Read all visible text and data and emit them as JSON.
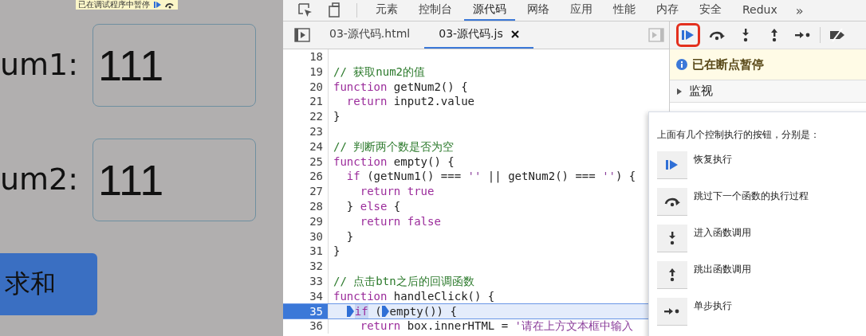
{
  "page": {
    "paused_badge": "已在调试程序中暂停",
    "fields": [
      {
        "label": "um1:",
        "value": "111"
      },
      {
        "label": "um2:",
        "value": "111"
      }
    ],
    "button": "求和"
  },
  "devtools": {
    "tabs": [
      {
        "label": "元素",
        "selected": false
      },
      {
        "label": "控制台",
        "selected": false
      },
      {
        "label": "源代码",
        "selected": true
      },
      {
        "label": "网络",
        "selected": false
      },
      {
        "label": "应用",
        "selected": false
      },
      {
        "label": "性能",
        "selected": false
      },
      {
        "label": "内存",
        "selected": false
      },
      {
        "label": "安全",
        "selected": false
      },
      {
        "label": "Redux",
        "selected": false
      }
    ],
    "more": "»",
    "file_tabs": [
      {
        "label": "03-源代码.html",
        "selected": false,
        "closable": false
      },
      {
        "label": "03-源代码.js",
        "selected": true,
        "closable": true
      }
    ],
    "code": [
      {
        "number": "18",
        "current": false
      },
      {
        "number": "19",
        "current": false,
        "segments": [
          {
            "kind": "comment",
            "text": "// 获取num2的值"
          }
        ]
      },
      {
        "number": "20",
        "current": false,
        "segments": [
          {
            "kind": "keyword",
            "text": "function"
          },
          {
            "kind": "plain",
            "text": " getNum2() {"
          }
        ]
      },
      {
        "number": "21",
        "current": false,
        "segments": [
          {
            "kind": "keyword",
            "text": "  return"
          },
          {
            "kind": "plain",
            "text": " input2.value"
          }
        ]
      },
      {
        "number": "22",
        "current": false,
        "segments": [
          {
            "kind": "plain",
            "text": "}"
          }
        ]
      },
      {
        "number": "23",
        "current": false
      },
      {
        "number": "24",
        "current": false,
        "segments": [
          {
            "kind": "comment",
            "text": "// 判断两个数是否为空"
          }
        ]
      },
      {
        "number": "25",
        "current": false,
        "segments": [
          {
            "kind": "keyword",
            "text": "function"
          },
          {
            "kind": "plain",
            "text": " empty() {"
          }
        ]
      },
      {
        "number": "26",
        "current": false,
        "segments": [
          {
            "kind": "keyword",
            "text": "  if"
          },
          {
            "kind": "plain",
            "text": " (getNum1() === "
          },
          {
            "kind": "string",
            "text": "''"
          },
          {
            "kind": "plain",
            "text": " || getNum2() === "
          },
          {
            "kind": "string",
            "text": "''"
          },
          {
            "kind": "plain",
            "text": ") {"
          }
        ]
      },
      {
        "number": "27",
        "current": false,
        "segments": [
          {
            "kind": "keyword",
            "text": "    return"
          },
          {
            "kind": "keyword",
            "text": " true"
          }
        ]
      },
      {
        "number": "28",
        "current": false,
        "segments": [
          {
            "kind": "plain",
            "text": "  } "
          },
          {
            "kind": "keyword",
            "text": "else"
          },
          {
            "kind": "plain",
            "text": " {"
          }
        ]
      },
      {
        "number": "29",
        "current": false,
        "segments": [
          {
            "kind": "keyword",
            "text": "    return"
          },
          {
            "kind": "keyword",
            "text": " false"
          }
        ]
      },
      {
        "number": "30",
        "current": false,
        "segments": [
          {
            "kind": "plain",
            "text": "  }"
          }
        ]
      },
      {
        "number": "31",
        "current": false,
        "segments": [
          {
            "kind": "plain",
            "text": "}"
          }
        ]
      },
      {
        "number": "32",
        "current": false
      },
      {
        "number": "33",
        "current": false,
        "segments": [
          {
            "kind": "comment",
            "text": "// 点击btn之后的回调函数"
          }
        ]
      },
      {
        "number": "34",
        "current": false,
        "segments": [
          {
            "kind": "keyword",
            "text": "function"
          },
          {
            "kind": "plain",
            "text": " handleClick() {"
          }
        ]
      },
      {
        "number": "35",
        "current": true,
        "segments": [
          {
            "kind": "keyword",
            "text": "  if",
            "highlighted": true,
            "marker": true
          },
          {
            "kind": "plain",
            "text": " ("
          },
          {
            "kind": "plain",
            "text": "empty()) {",
            "marker": true
          }
        ]
      },
      {
        "number": "36",
        "current": false,
        "segments": [
          {
            "kind": "keyword",
            "text": "    return"
          },
          {
            "kind": "plain",
            "text": " box.innerHTML = "
          },
          {
            "kind": "string",
            "text": "'请在上方文本框中输入"
          }
        ]
      }
    ],
    "debug_toolbar": [
      {
        "kind": "resume",
        "highlighted": true
      },
      {
        "kind": "step-over",
        "highlighted": false
      },
      {
        "kind": "step-into",
        "highlighted": false
      },
      {
        "kind": "step-out",
        "highlighted": false
      },
      {
        "kind": "step",
        "highlighted": false
      },
      {
        "kind": "deactivate",
        "highlighted": false
      }
    ],
    "paused_banner": "已在断点暂停",
    "sections": [
      {
        "label": "监视",
        "expanded": false
      }
    ],
    "tooltip": {
      "intro": "上面有几个控制执行的按钮，分别是：",
      "items": [
        {
          "kind": "resume",
          "label": "恢复执行"
        },
        {
          "kind": "step-over",
          "label": "跳过下一个函数的执行过程"
        },
        {
          "kind": "step-into",
          "label": "进入函数调用"
        },
        {
          "kind": "step-out",
          "label": "跳出函数调用"
        },
        {
          "kind": "step",
          "label": "单步执行"
        }
      ]
    }
  }
}
